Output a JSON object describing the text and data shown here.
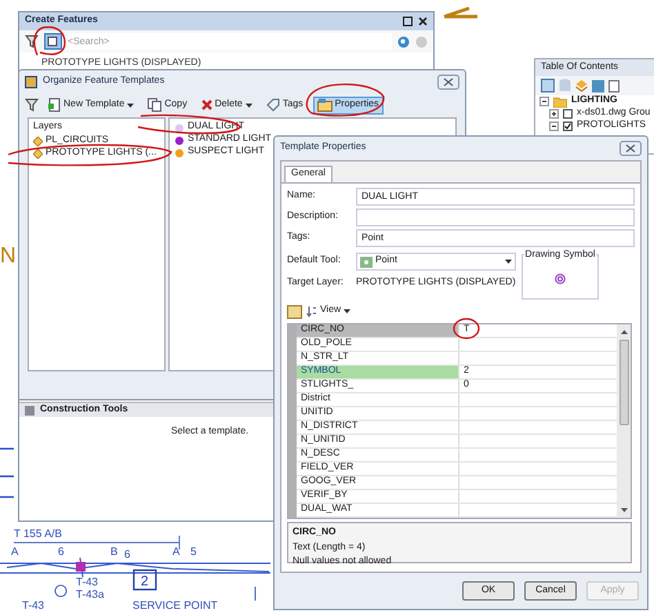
{
  "map": {
    "labels": [
      {
        "text": "N",
        "kind": "big"
      },
      {
        "text": "T 155 A/B",
        "kind": "small"
      },
      {
        "text": "A",
        "kind": "small"
      },
      {
        "text": "6",
        "kind": "small"
      },
      {
        "text": "B",
        "kind": "small"
      },
      {
        "text": "6",
        "kind": "small"
      },
      {
        "text": "A",
        "kind": "small"
      },
      {
        "text": "5",
        "kind": "small"
      },
      {
        "text": "T-43",
        "kind": "small"
      },
      {
        "text": "T-43a",
        "kind": "small"
      },
      {
        "text": "2",
        "kind": "boxed"
      },
      {
        "text": "T-43",
        "kind": "small"
      },
      {
        "text": "SERVICE POINT",
        "kind": "small"
      }
    ]
  },
  "create_features": {
    "title": "Create Features",
    "search_placeholder": "<Search>",
    "layer": "PROTOTYPE LIGHTS (DISPLAYED)",
    "construction_tools": {
      "title": "Construction Tools",
      "message": "Select a template."
    }
  },
  "organize": {
    "title": "Organize Feature Templates",
    "toolbar": [
      {
        "kind": "new",
        "label": "New Template",
        "dropdown": true,
        "selected": false
      },
      {
        "kind": "copy",
        "label": "Copy",
        "dropdown": false,
        "selected": false
      },
      {
        "kind": "delete",
        "label": "Delete",
        "dropdown": true,
        "selected": false
      },
      {
        "kind": "tags",
        "label": "Tags",
        "dropdown": false,
        "selected": false
      },
      {
        "kind": "properties",
        "label": "Properties",
        "dropdown": false,
        "selected": true
      }
    ],
    "layers_header": "Layers",
    "layers": [
      {
        "label": "PL_CIRCUITS"
      },
      {
        "label": "PROTOTYPE LIGHTS (..."
      }
    ],
    "templates": [
      {
        "label": "DUAL LIGHT",
        "color": "#dcc8f0"
      },
      {
        "label": "STANDARD LIGHT",
        "color": "#9a20c8"
      },
      {
        "label": "SUSPECT LIGHT",
        "color": "#f0a020"
      }
    ]
  },
  "toc": {
    "title": "Table Of Contents",
    "tree": [
      {
        "label": "LIGHTING",
        "expanded": true,
        "children": [
          {
            "label": "x-ds01.dwg Grou",
            "expanded": false,
            "checked": false
          },
          {
            "label": "PROTOLIGHTS",
            "expanded": true,
            "checked": true
          }
        ]
      }
    ]
  },
  "template_properties": {
    "title": "Template Properties",
    "tab": "General",
    "name": {
      "label": "Name:",
      "value": "DUAL LIGHT"
    },
    "description": {
      "label": "Description:"
    },
    "tags": {
      "label": "Tags:",
      "value": "Point"
    },
    "default_tool": {
      "label": "Default Tool:",
      "value": "Point"
    },
    "drawing_symbol": "Drawing Symbol",
    "target_layer": {
      "label": "Target Layer:",
      "value": "PROTOTYPE LIGHTS (DISPLAYED)"
    },
    "view": "View",
    "attributes": [
      {
        "field": "CIRC_NO",
        "value": "T",
        "selected": true,
        "highlighted": false
      },
      {
        "field": "OLD_POLE",
        "selected": false,
        "highlighted": false
      },
      {
        "field": "N_STR_LT",
        "selected": false,
        "highlighted": false
      },
      {
        "field": "SYMBOL",
        "value": "2",
        "selected": false,
        "highlighted": true
      },
      {
        "field": "STLIGHTS_",
        "value": "0",
        "selected": false,
        "highlighted": false
      },
      {
        "field": "District",
        "selected": false,
        "highlighted": false
      },
      {
        "field": "UNITID",
        "selected": false,
        "highlighted": false
      },
      {
        "field": "N_DISTRICT",
        "selected": false,
        "highlighted": false
      },
      {
        "field": "N_UNITID",
        "selected": false,
        "highlighted": false
      },
      {
        "field": "N_DESC",
        "selected": false,
        "highlighted": false
      },
      {
        "field": "FIELD_VER",
        "selected": false,
        "highlighted": false
      },
      {
        "field": "GOOG_VER",
        "selected": false,
        "highlighted": false
      },
      {
        "field": "VERIF_BY",
        "selected": false,
        "highlighted": false
      },
      {
        "field": "DUAL_WAT",
        "selected": false,
        "highlighted": false
      }
    ],
    "info": {
      "field": "CIRC_NO",
      "type": "Text (Length = 4)",
      "note": "Null values not allowed"
    },
    "buttons": [
      {
        "label": "OK",
        "disabled": false
      },
      {
        "label": "Cancel",
        "disabled": false
      },
      {
        "label": "Apply",
        "disabled": true
      }
    ]
  }
}
